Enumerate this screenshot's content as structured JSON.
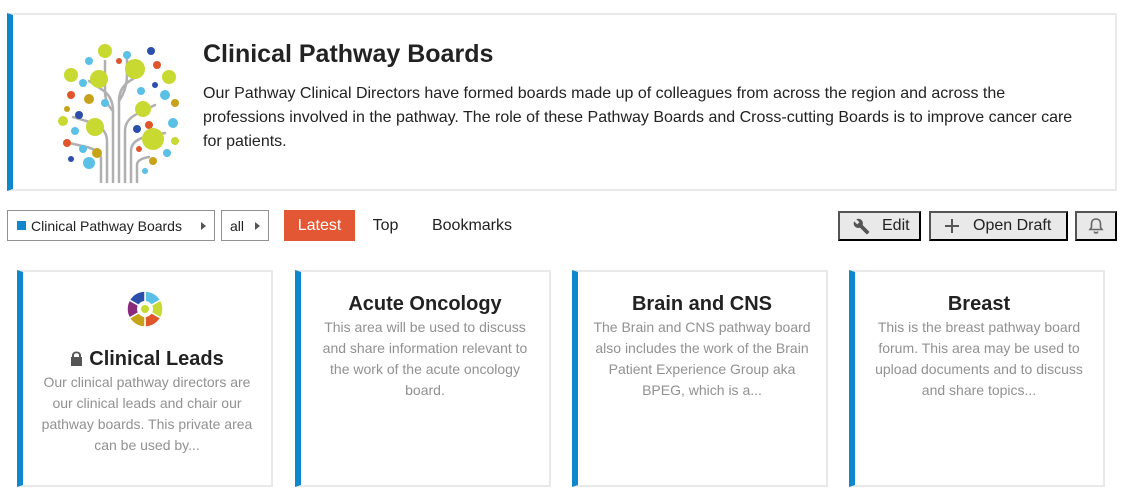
{
  "banner": {
    "title": "Clinical Pathway Boards",
    "description": "Our Pathway Clinical Directors have formed boards made up of colleagues from across the region and across the professions involved in the pathway. The role of these Pathway Boards and Cross-cutting Boards is to improve cancer care for patients.",
    "logo_icon": "tree-logo-icon"
  },
  "nav": {
    "category_dropdown": "Clinical Pathway Boards",
    "subcategory_dropdown": "all",
    "tabs": [
      {
        "label": "Latest",
        "active": true
      },
      {
        "label": "Top",
        "active": false
      },
      {
        "label": "Bookmarks",
        "active": false
      }
    ]
  },
  "actions": {
    "edit_label": "Edit",
    "open_draft_label": "Open Draft",
    "notifications_icon": "bell-icon"
  },
  "colors": {
    "accent": "#0e87cc",
    "active_tab": "#e45735",
    "button_bg": "#e9e9e9",
    "muted_text": "#919191"
  },
  "cards": [
    {
      "title": "Clinical Leads",
      "description": "Our clinical pathway directors are our clinical leads and chair our pathway boards. This private area can be used by...",
      "private": true
    },
    {
      "title": "Acute Oncology",
      "description": "This area will be used to discuss and share information relevant to the work of the acute oncology board.",
      "private": false
    },
    {
      "title": "Brain and CNS",
      "description": "The Brain and CNS pathway board also includes the work of the Brain Patient Experience Group aka BPEG, which is a...",
      "private": false
    },
    {
      "title": "Breast",
      "description": "This is the breast pathway board forum. This area may be used to upload documents and to discuss and share topics...",
      "private": false
    }
  ]
}
